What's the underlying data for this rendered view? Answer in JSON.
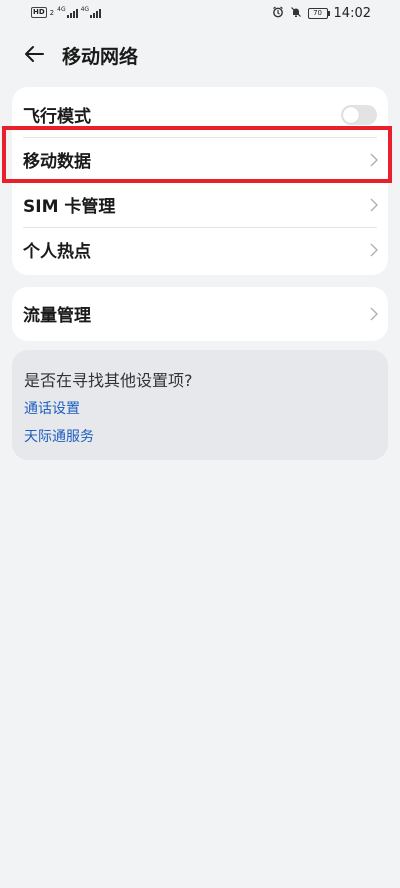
{
  "status_bar": {
    "hd_badge": "HD",
    "sim_slot": "2",
    "net_tag_1": "4G",
    "net_tag_2": "4G",
    "battery": "70",
    "time": "14:02"
  },
  "header": {
    "title": "移动网络"
  },
  "main_section": {
    "airplane_mode": {
      "label": "飞行模式",
      "enabled": false
    },
    "mobile_data": {
      "label": "移动数据"
    },
    "sim_management": {
      "label": "SIM 卡管理"
    },
    "hotspot": {
      "label": "个人热点"
    }
  },
  "traffic_section": {
    "traffic_management": {
      "label": "流量管理"
    }
  },
  "search_section": {
    "title": "是否在寻找其他设置项?",
    "links": [
      {
        "label": "通话设置"
      },
      {
        "label": "天际通服务"
      }
    ]
  },
  "colors": {
    "background": "#f1f3f5",
    "highlight": "#e8202b",
    "link": "#1f5fbf"
  }
}
